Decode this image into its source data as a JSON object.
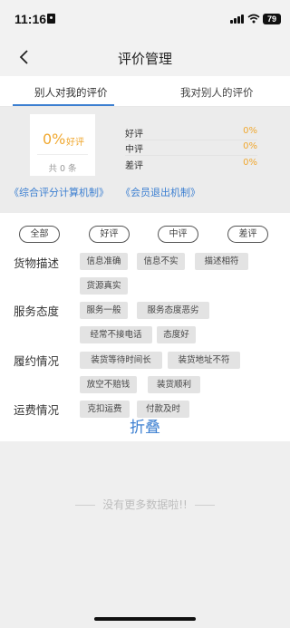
{
  "status_bar": {
    "time": "11:16",
    "battery": "79"
  },
  "nav": {
    "title": "评价管理"
  },
  "tabs": [
    {
      "label": "别人对我的评价",
      "active": true
    },
    {
      "label": "我对别人的评价",
      "active": false
    }
  ],
  "summary": {
    "score_percent": "0%",
    "score_label": "好评",
    "total": "共 0 条",
    "rates": [
      {
        "label": "好评",
        "value": "0%"
      },
      {
        "label": "中评",
        "value": "0%"
      },
      {
        "label": "差评",
        "value": "0%"
      }
    ],
    "links": [
      "《综合评分计算机制》",
      "《会员退出机制》"
    ]
  },
  "filter_pills": [
    "全部",
    "好评",
    "中评",
    "差评"
  ],
  "categories": [
    {
      "label": "货物描述",
      "tags": [
        "信息准确",
        "信息不实",
        "描述相符",
        "货源真实"
      ]
    },
    {
      "label": "服务态度",
      "tags": [
        "服务一般",
        "服务态度恶劣",
        "经常不接电话",
        "态度好"
      ]
    },
    {
      "label": "履约情况",
      "tags": [
        "装货等待时间长",
        "装货地址不符",
        "放空不赔钱",
        "装货顺利"
      ]
    },
    {
      "label": "运费情况",
      "tags": [
        "克扣运费",
        "付款及时"
      ]
    }
  ],
  "collapse_label": "折叠",
  "footer": {
    "no_more": "没有更多数据啦!!"
  },
  "colors": {
    "accent": "#3c7fd1",
    "rate": "#f0a830"
  }
}
